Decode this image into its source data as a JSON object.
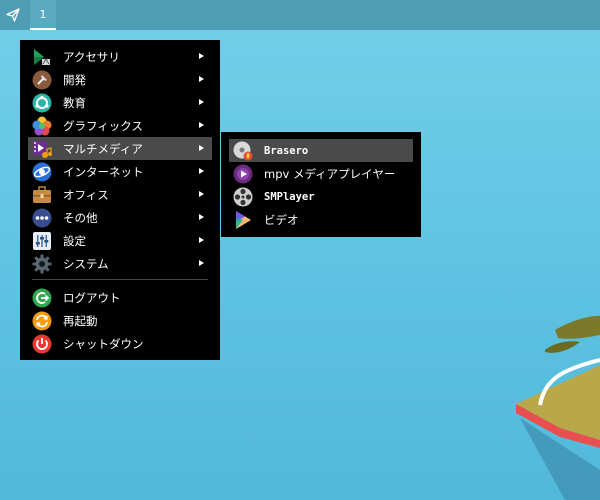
{
  "taskbar": {
    "launcher_icon": "paper-plane-icon",
    "workspace_label": "1"
  },
  "main_menu": {
    "items": [
      {
        "label": "アクセサリ",
        "icon": "accessories-icon",
        "submenu": true
      },
      {
        "label": "開発",
        "icon": "development-icon",
        "submenu": true
      },
      {
        "label": "教育",
        "icon": "education-icon",
        "submenu": true
      },
      {
        "label": "グラフィックス",
        "icon": "graphics-icon",
        "submenu": true
      },
      {
        "label": "マルチメディア",
        "icon": "multimedia-icon",
        "submenu": true,
        "selected": true
      },
      {
        "label": "インターネット",
        "icon": "internet-icon",
        "submenu": true
      },
      {
        "label": "オフィス",
        "icon": "office-icon",
        "submenu": true
      },
      {
        "label": "その他",
        "icon": "other-icon",
        "submenu": true
      },
      {
        "label": "設定",
        "icon": "settings-icon",
        "submenu": true
      },
      {
        "label": "システム",
        "icon": "system-icon",
        "submenu": true
      }
    ],
    "session_items": [
      {
        "label": "ログアウト",
        "icon": "logout-icon"
      },
      {
        "label": "再起動",
        "icon": "reboot-icon"
      },
      {
        "label": "シャットダウン",
        "icon": "shutdown-icon"
      }
    ]
  },
  "multimedia_submenu": {
    "items": [
      {
        "label": "Brasero",
        "icon": "brasero-icon",
        "selected": true
      },
      {
        "label": "mpv メディアプレイヤー",
        "icon": "mpv-icon"
      },
      {
        "label": "SMPlayer",
        "icon": "smplayer-icon"
      },
      {
        "label": "ビデオ",
        "icon": "video-icon"
      }
    ]
  },
  "colors": {
    "desktop": "#5ec3e2",
    "taskbar": "#4f9db4",
    "menu_bg": "#000000",
    "menu_selected": "#4a4a4a"
  }
}
